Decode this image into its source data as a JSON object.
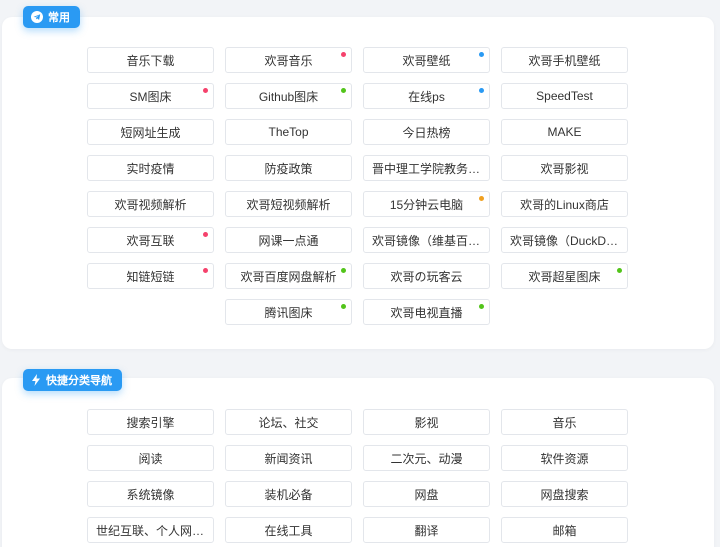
{
  "colors": {
    "accent": "#2a9af3",
    "dot_red": "#f5416c",
    "dot_blue": "#2a9af3",
    "dot_green": "#52c41a",
    "dot_orange": "#f0a020"
  },
  "sections": {
    "common": {
      "title": "常用",
      "icon": "telegram-icon",
      "items": [
        {
          "label": "音乐下载",
          "dot": null
        },
        {
          "label": "欢哥音乐",
          "dot": "red"
        },
        {
          "label": "欢哥壁纸",
          "dot": "blue"
        },
        {
          "label": "欢哥手机壁纸",
          "dot": null
        },
        {
          "label": "SM图床",
          "dot": "red"
        },
        {
          "label": "Github图床",
          "dot": "green"
        },
        {
          "label": "在线ps",
          "dot": "blue"
        },
        {
          "label": "SpeedTest",
          "dot": null
        },
        {
          "label": "短网址生成",
          "dot": null
        },
        {
          "label": "TheTop",
          "dot": null
        },
        {
          "label": "今日热榜",
          "dot": null
        },
        {
          "label": "MAKE",
          "dot": null
        },
        {
          "label": "实时疫情",
          "dot": null
        },
        {
          "label": "防疫政策",
          "dot": null
        },
        {
          "label": "晋中理工学院教务系统",
          "dot": null
        },
        {
          "label": "欢哥影视",
          "dot": null
        },
        {
          "label": "欢哥视频解析",
          "dot": null
        },
        {
          "label": "欢哥短视频解析",
          "dot": null
        },
        {
          "label": "15分钟云电脑",
          "dot": "orange"
        },
        {
          "label": "欢哥的Linux商店",
          "dot": null
        },
        {
          "label": "欢哥互联",
          "dot": "red"
        },
        {
          "label": "网课一点通",
          "dot": null
        },
        {
          "label": "欢哥镜像（维基百科）",
          "dot": null
        },
        {
          "label": "欢哥镜像（DuckDuckGo）",
          "dot": null
        },
        {
          "label": "知链短链",
          "dot": "red"
        },
        {
          "label": "欢哥百度网盘解析",
          "dot": "green"
        },
        {
          "label": "欢哥の玩客云",
          "dot": null
        },
        {
          "label": "欢哥超星图床",
          "dot": "green"
        },
        {
          "label": "",
          "dot": null,
          "empty": true
        },
        {
          "label": "腾讯图床",
          "dot": "green"
        },
        {
          "label": "欢哥电视直播",
          "dot": "green"
        }
      ]
    },
    "nav": {
      "title": "快捷分类导航",
      "icon": "lightning-icon",
      "items": [
        {
          "label": "搜索引擎",
          "dot": null
        },
        {
          "label": "论坛、社交",
          "dot": null
        },
        {
          "label": "影视",
          "dot": null
        },
        {
          "label": "音乐",
          "dot": null
        },
        {
          "label": "阅读",
          "dot": null
        },
        {
          "label": "新闻资讯",
          "dot": null
        },
        {
          "label": "二次元、动漫",
          "dot": null
        },
        {
          "label": "软件资源",
          "dot": null
        },
        {
          "label": "系统镜像",
          "dot": null
        },
        {
          "label": "装机必备",
          "dot": null
        },
        {
          "label": "网盘",
          "dot": null
        },
        {
          "label": "网盘搜索",
          "dot": null
        },
        {
          "label": "世纪互联、个人网站导航",
          "dot": null
        },
        {
          "label": "在线工具",
          "dot": null
        },
        {
          "label": "翻译",
          "dot": null
        },
        {
          "label": "邮箱",
          "dot": null
        }
      ]
    }
  }
}
